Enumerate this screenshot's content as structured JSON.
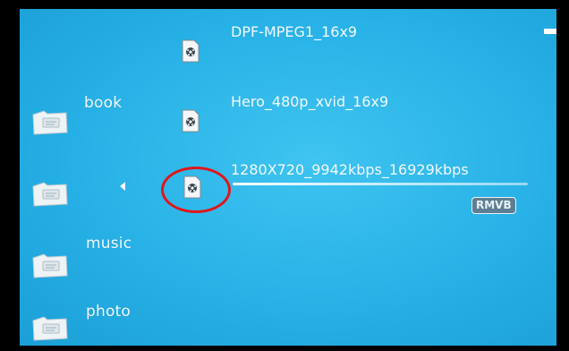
{
  "folders": [
    {
      "label": "book"
    },
    {
      "label": ""
    },
    {
      "label": "music"
    },
    {
      "label": "photo"
    }
  ],
  "files": [
    {
      "name": "DPF-MPEG1_16x9"
    },
    {
      "name": "Hero_480p_xvid_16x9"
    },
    {
      "name": "1280X720_9942kbps_16929kbps"
    }
  ],
  "selected_format_badge": "RMVB",
  "colors": {
    "background": "#27b1e6",
    "highlight_ring": "#e0161a",
    "badge": "#5e7f92"
  }
}
